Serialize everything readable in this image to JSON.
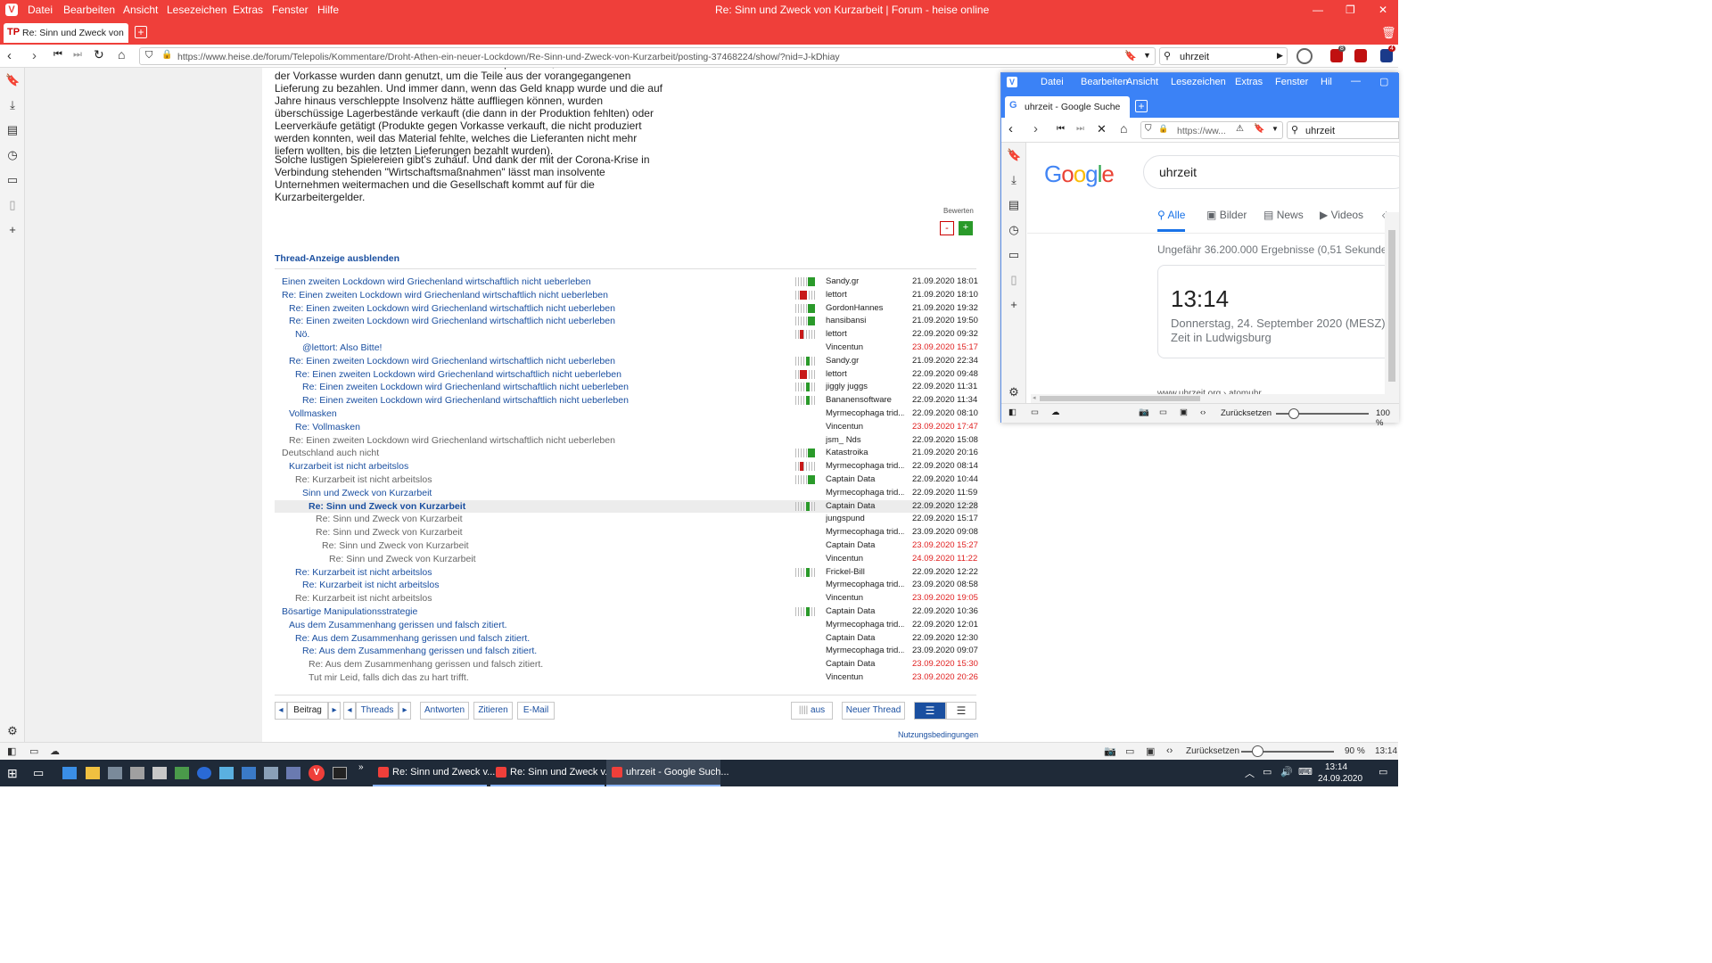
{
  "window_title": "Re: Sinn und Zweck von Kurzarbeit | Forum - heise online",
  "menu": [
    "Datei",
    "Bearbeiten",
    "Ansicht",
    "Lesezeichen",
    "Extras",
    "Fenster",
    "Hilfe"
  ],
  "tab": {
    "label": "Re: Sinn und Zweck von Ku"
  },
  "address": {
    "url": "https://www.heise.de/forum/Telepolis/Kommentare/Droht-Athen-ein-neuer-Lockdown/Re-Sinn-und-Zweck-von-Kurzarbeit/posting-37468224/show/?nid=J-kDhiay",
    "search": "uhrzeit"
  },
  "badges": {
    "extension1": "8",
    "extension2": "4"
  },
  "article": {
    "para1": "kein. Produkte wurden mit nichtbezahlten Teilen produziert, die Einnahmen aus der Vorkasse wurden dann genutzt, um die Teile aus der vorangegangenen Lieferung zu bezahlen. Und immer dann, wenn das Geld knapp wurde und die auf Jahre hinaus verschleppte Insolvenz hätte auffliegen können, wurden überschüssige Lagerbestände verkauft (die dann in der Produktion fehlten) oder Leerverkäufe getätigt (Produkte gegen Vorkasse verkauft, die nicht produziert werden konnten, weil das Material fehlte, welches die Lieferanten nicht mehr liefern wollten, bis die letzten Lieferungen bezahlt wurden).",
    "para2": "Solche lustigen Spielereien gibt's zuhauf. Und dank der mit der Corona-Krise in Verbindung stehenden \"Wirtschaftsmaßnahmen\" lässt man insolvente Unternehmen weitermachen und die Gesellschaft kommt auf für die Kurzarbeitergelder.",
    "rate_label": "Bewerten",
    "rate_minus": "-",
    "rate_plus": "+"
  },
  "thread_toggle": "Thread-Anzeige ausblenden",
  "threads": [
    {
      "title": "Einen zweiten Lockdown wird Griechenland wirtschaftlich nicht ueberleben",
      "user": "Sandy.gr",
      "date": "21.09.2020 18:01",
      "depth": 0,
      "read": false,
      "new": false,
      "rating": "green"
    },
    {
      "title": "Re: Einen zweiten Lockdown wird Griechenland wirtschaftlich nicht ueberleben",
      "user": "lettort",
      "date": "21.09.2020 18:10",
      "depth": 0,
      "read": false,
      "new": false,
      "rating": "red"
    },
    {
      "title": "Re: Einen zweiten Lockdown wird Griechenland wirtschaftlich nicht ueberleben",
      "user": "GordonHannes",
      "date": "21.09.2020 19:32",
      "depth": 1,
      "read": false,
      "new": false,
      "rating": "green"
    },
    {
      "title": "Re: Einen zweiten Lockdown wird Griechenland wirtschaftlich nicht ueberleben",
      "user": "hansibansi",
      "date": "21.09.2020 19:50",
      "depth": 1,
      "read": false,
      "new": false,
      "rating": "green"
    },
    {
      "title": "Nö.",
      "user": "lettort",
      "date": "22.09.2020 09:32",
      "depth": 2,
      "read": false,
      "new": false,
      "rating": "redsmall"
    },
    {
      "title": "@lettort: Also Bitte!",
      "user": "Vincentun",
      "date": "23.09.2020 15:17",
      "depth": 3,
      "read": false,
      "new": true,
      "rating": "none"
    },
    {
      "title": "Re: Einen zweiten Lockdown wird Griechenland wirtschaftlich nicht ueberleben",
      "user": "Sandy.gr",
      "date": "21.09.2020 22:34",
      "depth": 1,
      "read": false,
      "new": false,
      "rating": "greensmall"
    },
    {
      "title": "Re: Einen zweiten Lockdown wird Griechenland wirtschaftlich nicht ueberleben",
      "user": "lettort",
      "date": "22.09.2020 09:48",
      "depth": 2,
      "read": false,
      "new": false,
      "rating": "red"
    },
    {
      "title": "Re: Einen zweiten Lockdown wird Griechenland wirtschaftlich nicht ueberleben",
      "user": "jiggly juggs",
      "date": "22.09.2020 11:31",
      "depth": 3,
      "read": false,
      "new": false,
      "rating": "greensmall"
    },
    {
      "title": "Re: Einen zweiten Lockdown wird Griechenland wirtschaftlich nicht ueberleben",
      "user": "Bananensoftware",
      "date": "22.09.2020 11:34",
      "depth": 3,
      "read": false,
      "new": false,
      "rating": "greensmall"
    },
    {
      "title": "Vollmasken",
      "user": "Myrmecophaga trid...",
      "date": "22.09.2020 08:10",
      "depth": 1,
      "read": false,
      "new": false,
      "rating": "none"
    },
    {
      "title": "Re: Vollmasken",
      "user": "Vincentun",
      "date": "23.09.2020 17:47",
      "depth": 2,
      "read": false,
      "new": true,
      "rating": "none"
    },
    {
      "title": "Re: Einen zweiten Lockdown wird Griechenland wirtschaftlich nicht ueberleben",
      "user": "jsm_ Nds",
      "date": "22.09.2020 15:08",
      "depth": 1,
      "read": true,
      "new": false,
      "rating": "none"
    },
    {
      "title": "Deutschland auch nicht",
      "user": "Katastroika",
      "date": "21.09.2020 20:16",
      "depth": 0,
      "read": true,
      "new": false,
      "rating": "green"
    },
    {
      "title": "Kurzarbeit ist nicht arbeitslos",
      "user": "Myrmecophaga trid...",
      "date": "22.09.2020 08:14",
      "depth": 1,
      "read": false,
      "new": false,
      "rating": "redsmall"
    },
    {
      "title": "Re: Kurzarbeit ist nicht arbeitslos",
      "user": "Captain Data",
      "date": "22.09.2020 10:44",
      "depth": 2,
      "read": true,
      "new": false,
      "rating": "green"
    },
    {
      "title": "Sinn und Zweck von Kurzarbeit",
      "user": "Myrmecophaga trid...",
      "date": "22.09.2020 11:59",
      "depth": 3,
      "read": false,
      "new": false,
      "rating": "none"
    },
    {
      "title": "Re: Sinn und Zweck von Kurzarbeit",
      "user": "Captain Data",
      "date": "22.09.2020 12:28",
      "depth": 4,
      "read": false,
      "new": false,
      "rating": "greensmall",
      "current": true
    },
    {
      "title": "Re: Sinn und Zweck von Kurzarbeit",
      "user": "jungspund",
      "date": "22.09.2020 15:17",
      "depth": 5,
      "read": true,
      "new": false,
      "rating": "none"
    },
    {
      "title": "Re: Sinn und Zweck von Kurzarbeit",
      "user": "Myrmecophaga trid...",
      "date": "23.09.2020 09:08",
      "depth": 5,
      "read": true,
      "new": false,
      "rating": "none"
    },
    {
      "title": "Re: Sinn und Zweck von Kurzarbeit",
      "user": "Captain Data",
      "date": "23.09.2020 15:27",
      "depth": 6,
      "read": true,
      "new": true,
      "rating": "none"
    },
    {
      "title": "Re: Sinn und Zweck von Kurzarbeit",
      "user": "Vincentun",
      "date": "24.09.2020 11:22",
      "depth": 7,
      "read": true,
      "new": true,
      "rating": "none"
    },
    {
      "title": "Re: Kurzarbeit ist nicht arbeitslos",
      "user": "Frickel-Bill",
      "date": "22.09.2020 12:22",
      "depth": 2,
      "read": false,
      "new": false,
      "rating": "greensmall"
    },
    {
      "title": "Re: Kurzarbeit ist nicht arbeitslos",
      "user": "Myrmecophaga trid...",
      "date": "23.09.2020 08:58",
      "depth": 3,
      "read": false,
      "new": false,
      "rating": "none"
    },
    {
      "title": "Re: Kurzarbeit ist nicht arbeitslos",
      "user": "Vincentun",
      "date": "23.09.2020 19:05",
      "depth": 2,
      "read": true,
      "new": true,
      "rating": "none"
    },
    {
      "title": "Bösartige Manipulationsstrategie",
      "user": "Captain Data",
      "date": "22.09.2020 10:36",
      "depth": 0,
      "read": false,
      "new": false,
      "rating": "greensmall"
    },
    {
      "title": "Aus dem Zusammenhang gerissen und falsch zitiert.",
      "user": "Myrmecophaga trid...",
      "date": "22.09.2020 12:01",
      "depth": 1,
      "read": false,
      "new": false,
      "rating": "none"
    },
    {
      "title": "Re: Aus dem Zusammenhang gerissen und falsch zitiert.",
      "user": "Captain Data",
      "date": "22.09.2020 12:30",
      "depth": 2,
      "read": false,
      "new": false,
      "rating": "none"
    },
    {
      "title": "Re: Aus dem Zusammenhang gerissen und falsch zitiert.",
      "user": "Myrmecophaga trid...",
      "date": "23.09.2020 09:07",
      "depth": 3,
      "read": false,
      "new": false,
      "rating": "none"
    },
    {
      "title": "Re: Aus dem Zusammenhang gerissen und falsch zitiert.",
      "user": "Captain Data",
      "date": "23.09.2020 15:30",
      "depth": 4,
      "read": true,
      "new": true,
      "rating": "none"
    },
    {
      "title": "Tut mir Leid, falls dich das zu hart trifft.",
      "user": "Vincentun",
      "date": "23.09.2020 20:26",
      "depth": 4,
      "read": true,
      "new": true,
      "rating": "none"
    }
  ],
  "nav": {
    "beitrag": "Beitrag",
    "threads": "Threads",
    "antworten": "Antworten",
    "zitieren": "Zitieren",
    "email": "E-Mail",
    "aus": "aus",
    "neuer_thread": "Neuer Thread",
    "nutzung": "Nutzungsbedingungen"
  },
  "popup": {
    "menu": [
      "Datei",
      "Bearbeiten",
      "Ansicht",
      "Lesezeichen",
      "Extras",
      "Fenster",
      "Hil"
    ],
    "tab": "uhrzeit - Google Suche",
    "url": "https://ww...",
    "search": "uhrzeit",
    "query": "uhrzeit",
    "tabs": [
      "Alle",
      "Bilder",
      "News",
      "Videos"
    ],
    "result_count": "Ungefähr 36.200.000 Ergebnisse (0,51 Sekunden)",
    "time": "13:14",
    "date": "Donnerstag, 24. September 2020 (MESZ)",
    "location": "Zeit in Ludwigsburg",
    "cut_link": "www.uhrzeit.org › atomuhr",
    "reset": "Zurücksetzen",
    "zoom": "100 %"
  },
  "status": {
    "reset": "Zurücksetzen",
    "zoom": "90 %",
    "time": "13:14"
  },
  "taskbar": {
    "items": [
      "Re: Sinn und Zweck v...",
      "Re: Sinn und Zweck v...",
      "uhrzeit - Google Such..."
    ],
    "time": "13:14",
    "date": "24.09.2020"
  },
  "colors": {
    "brand": "#ef3f3a",
    "link": "#1a4fa0",
    "new_date": "#e02020",
    "popup_accent": "#3b82f6"
  }
}
